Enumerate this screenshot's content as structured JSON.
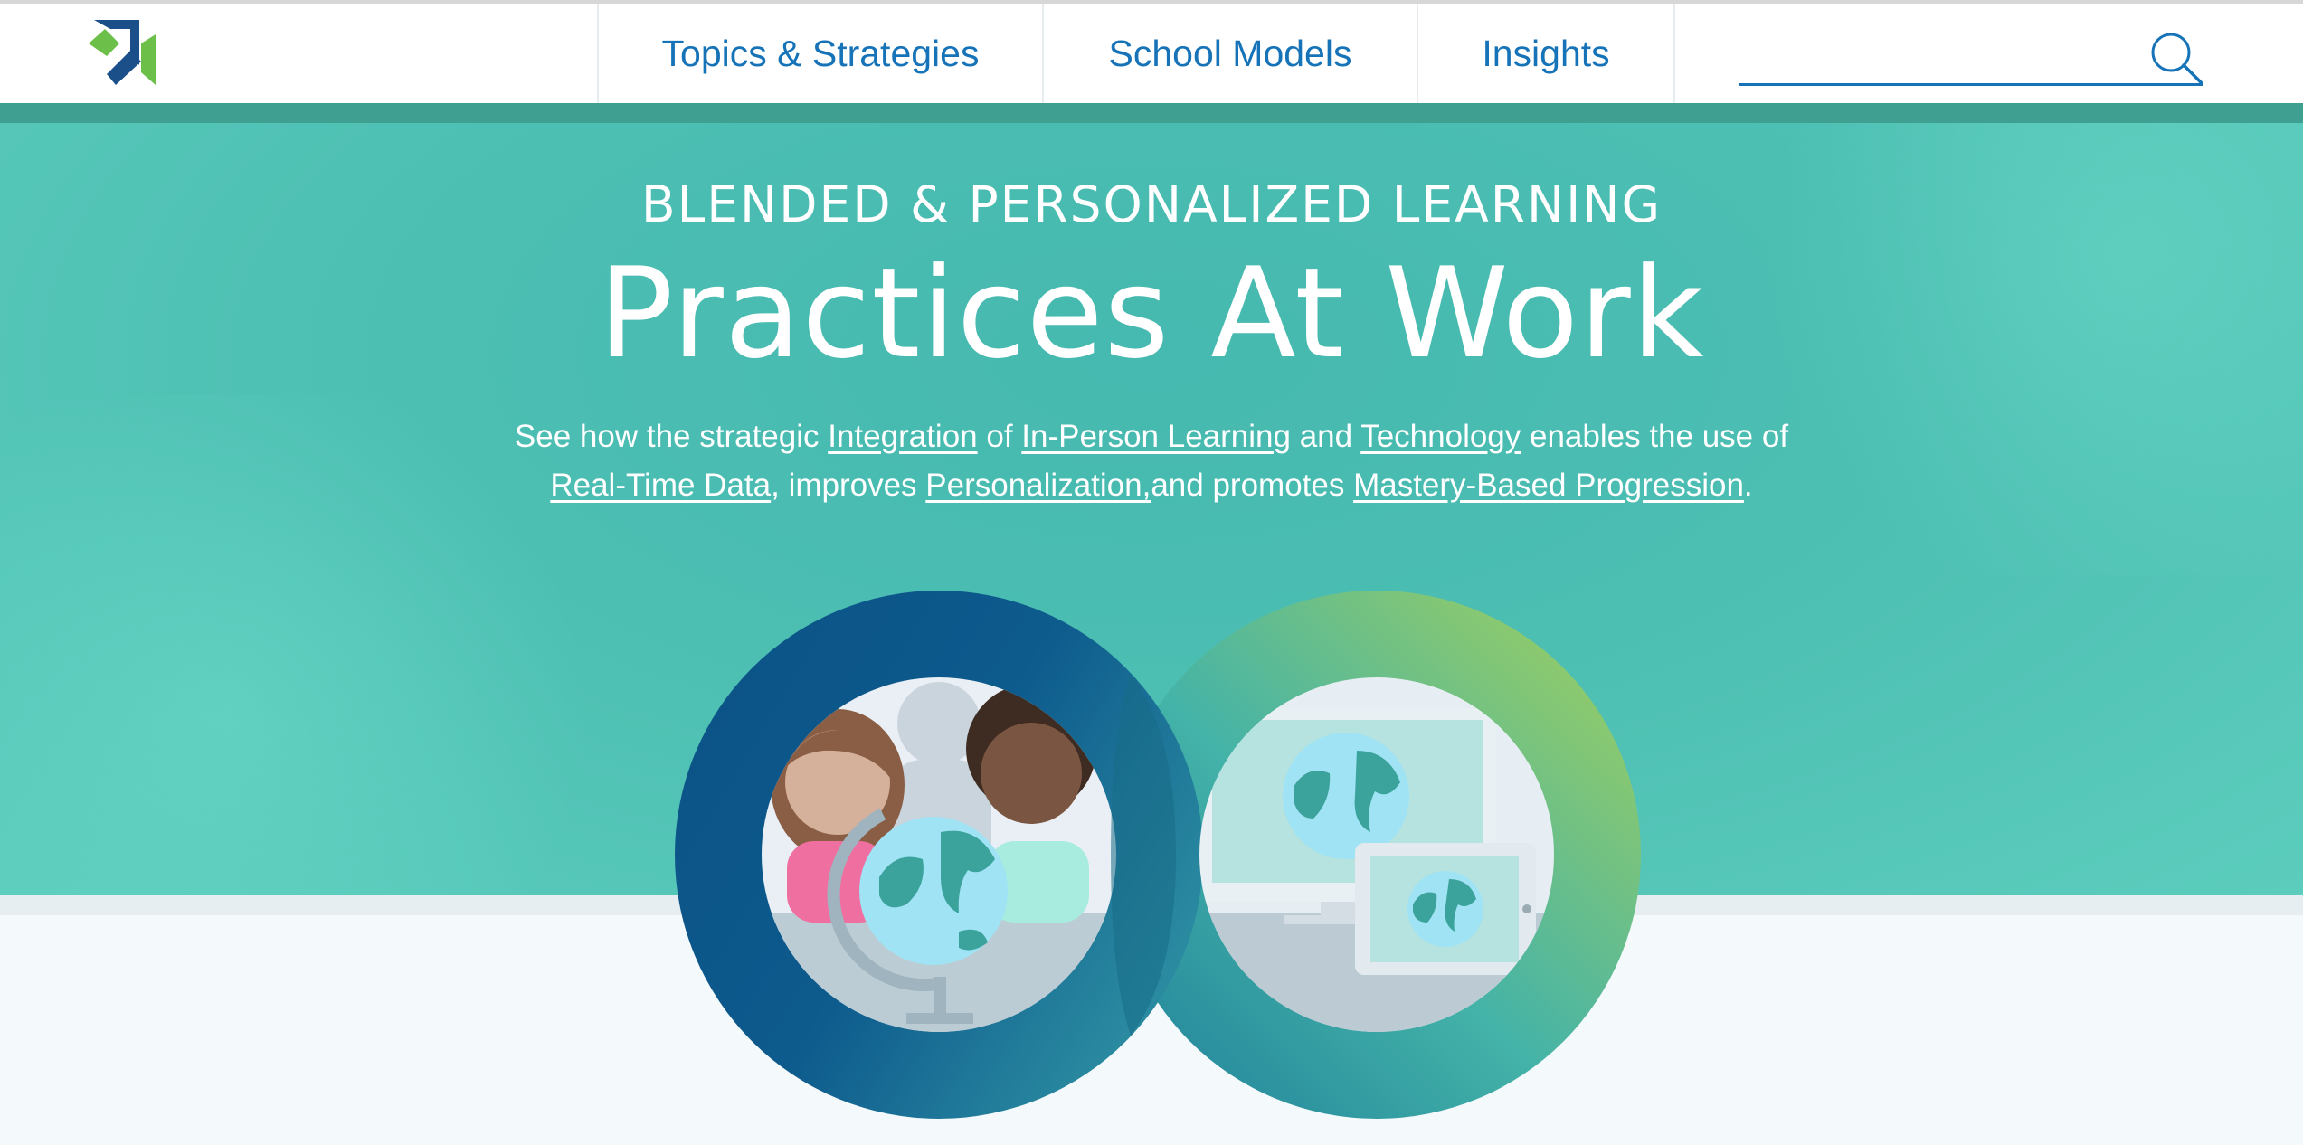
{
  "nav": {
    "items": [
      {
        "label": "Topics & Strategies"
      },
      {
        "label": "School Models"
      },
      {
        "label": "Insights"
      }
    ],
    "search": {
      "placeholder": "",
      "value": ""
    }
  },
  "hero": {
    "eyebrow": "BLENDED & PERSONALIZED LEARNING",
    "title": "Practices At Work",
    "intro": {
      "t1": "See how the strategic ",
      "link_integration": "Integration",
      "t2": " of ",
      "link_in_person": "In-Person Learning",
      "t3": " and ",
      "link_technology": "Technology",
      "t4": " enables the use of",
      "link_real_time": "Real-Time Data",
      "t5": ", improves ",
      "link_personalization": "Personalization,",
      "t6": "and promotes ",
      "link_mastery": "Mastery-Based Progression",
      "t7": "."
    }
  },
  "colors": {
    "nav_text": "#1673b8",
    "hero_teal": "#4cbeb2",
    "accent_strip": "#3f9f91",
    "ring_dark_blue": "#0b4f86",
    "ring_green": "#9acd5f"
  },
  "icons": [
    "logo-arrow-icon",
    "search-icon",
    "in-person-learning-illustration",
    "technology-illustration"
  ]
}
